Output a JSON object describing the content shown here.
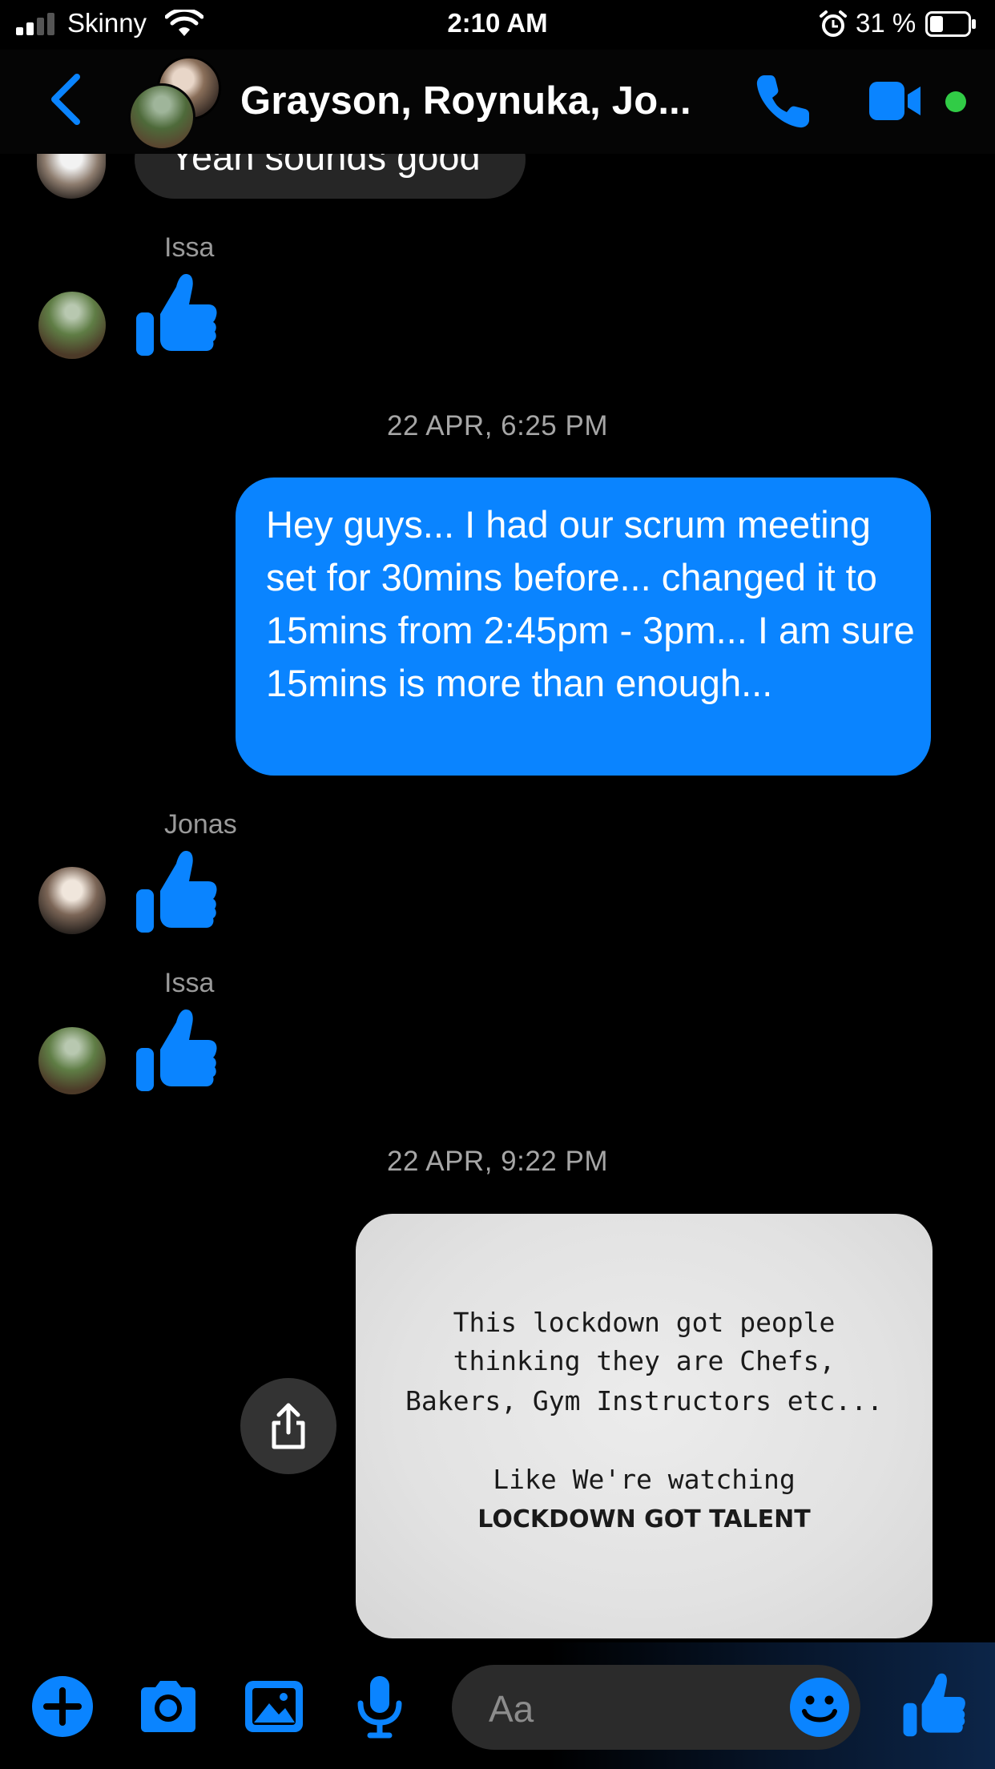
{
  "status_bar": {
    "carrier": "Skinny",
    "time": "2:10 AM",
    "battery": "31 %"
  },
  "header": {
    "title": "Grayson, Roynuka, Jo..."
  },
  "accent_color": "#0a84ff",
  "online_color": "#31cc46",
  "messages": {
    "partial_text": "Yeah sounds good",
    "issa_1": {
      "sender": "Issa"
    },
    "timestamp_1": "22 APR, 6:25 PM",
    "outgoing_1": "Hey guys... I had our scrum meeting set for 30mins before... changed it to 15mins from 2:45pm - 3pm... I am sure 15mins is more than enough...",
    "jonas_1": {
      "sender": "Jonas"
    },
    "issa_2": {
      "sender": "Issa"
    },
    "timestamp_2": "22 APR, 9:22 PM",
    "image_text": {
      "line1": "This lockdown got people",
      "line2": "thinking they are Chefs,",
      "line3": "Bakers, Gym Instructors etc...",
      "line4": "Like We're watching",
      "line5": "LOCKDOWN GOT TALENT"
    }
  },
  "composer": {
    "placeholder": "Aa"
  }
}
